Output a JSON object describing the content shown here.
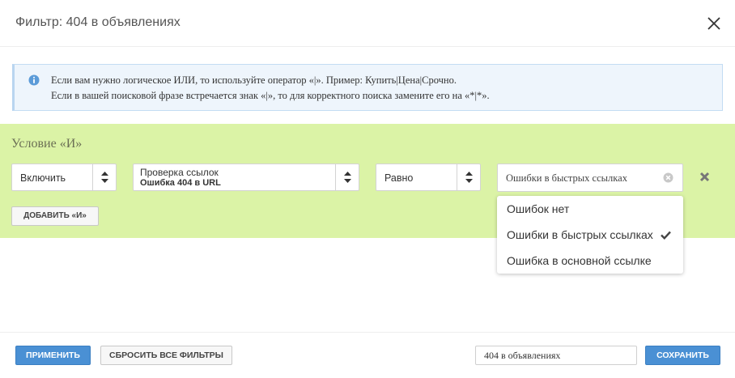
{
  "dialog": {
    "title": "Фильтр: 404 в объявлениях"
  },
  "info": {
    "line1": "Если вам нужно логическое ИЛИ, то используйте оператор «|». Пример: Купить|Цена|Срочно.",
    "line2": "Если в вашей поисковой фразе встречается знак «|», то для корректного поиска замените его на «*|*»."
  },
  "condition": {
    "title": "Условие «И»",
    "mode_select": "Включить",
    "field_select": {
      "group": "Проверка ссылок",
      "field": "Ошибка 404 в URL"
    },
    "operator_select": "Равно",
    "value": "Ошибки в быстрых ссылках",
    "add_button": "ДОБАВИТЬ «И»"
  },
  "dropdown": {
    "options": [
      {
        "label": "Ошибок нет",
        "selected": false
      },
      {
        "label": "Ошибки в быстрых ссылках",
        "selected": true
      },
      {
        "label": "Ошибка в основной ссылке",
        "selected": false
      }
    ]
  },
  "footer": {
    "apply_button": "ПРИМЕНИТЬ",
    "reset_button": "СБРОСИТЬ ВСЕ ФИЛЬТРЫ",
    "filter_name": "404 в объявлениях",
    "save_button": "СОХРАНИТЬ"
  },
  "colors": {
    "condition_bg": "#dbf3a6",
    "info_bg": "#eef5fc",
    "primary_button": "#4a90d4"
  },
  "icons": {
    "close": "close-icon",
    "info": "info-icon",
    "sort_arrows": "sort-arrows-icon",
    "clear": "clear-circle-icon",
    "remove": "remove-x-icon",
    "check": "check-icon"
  }
}
